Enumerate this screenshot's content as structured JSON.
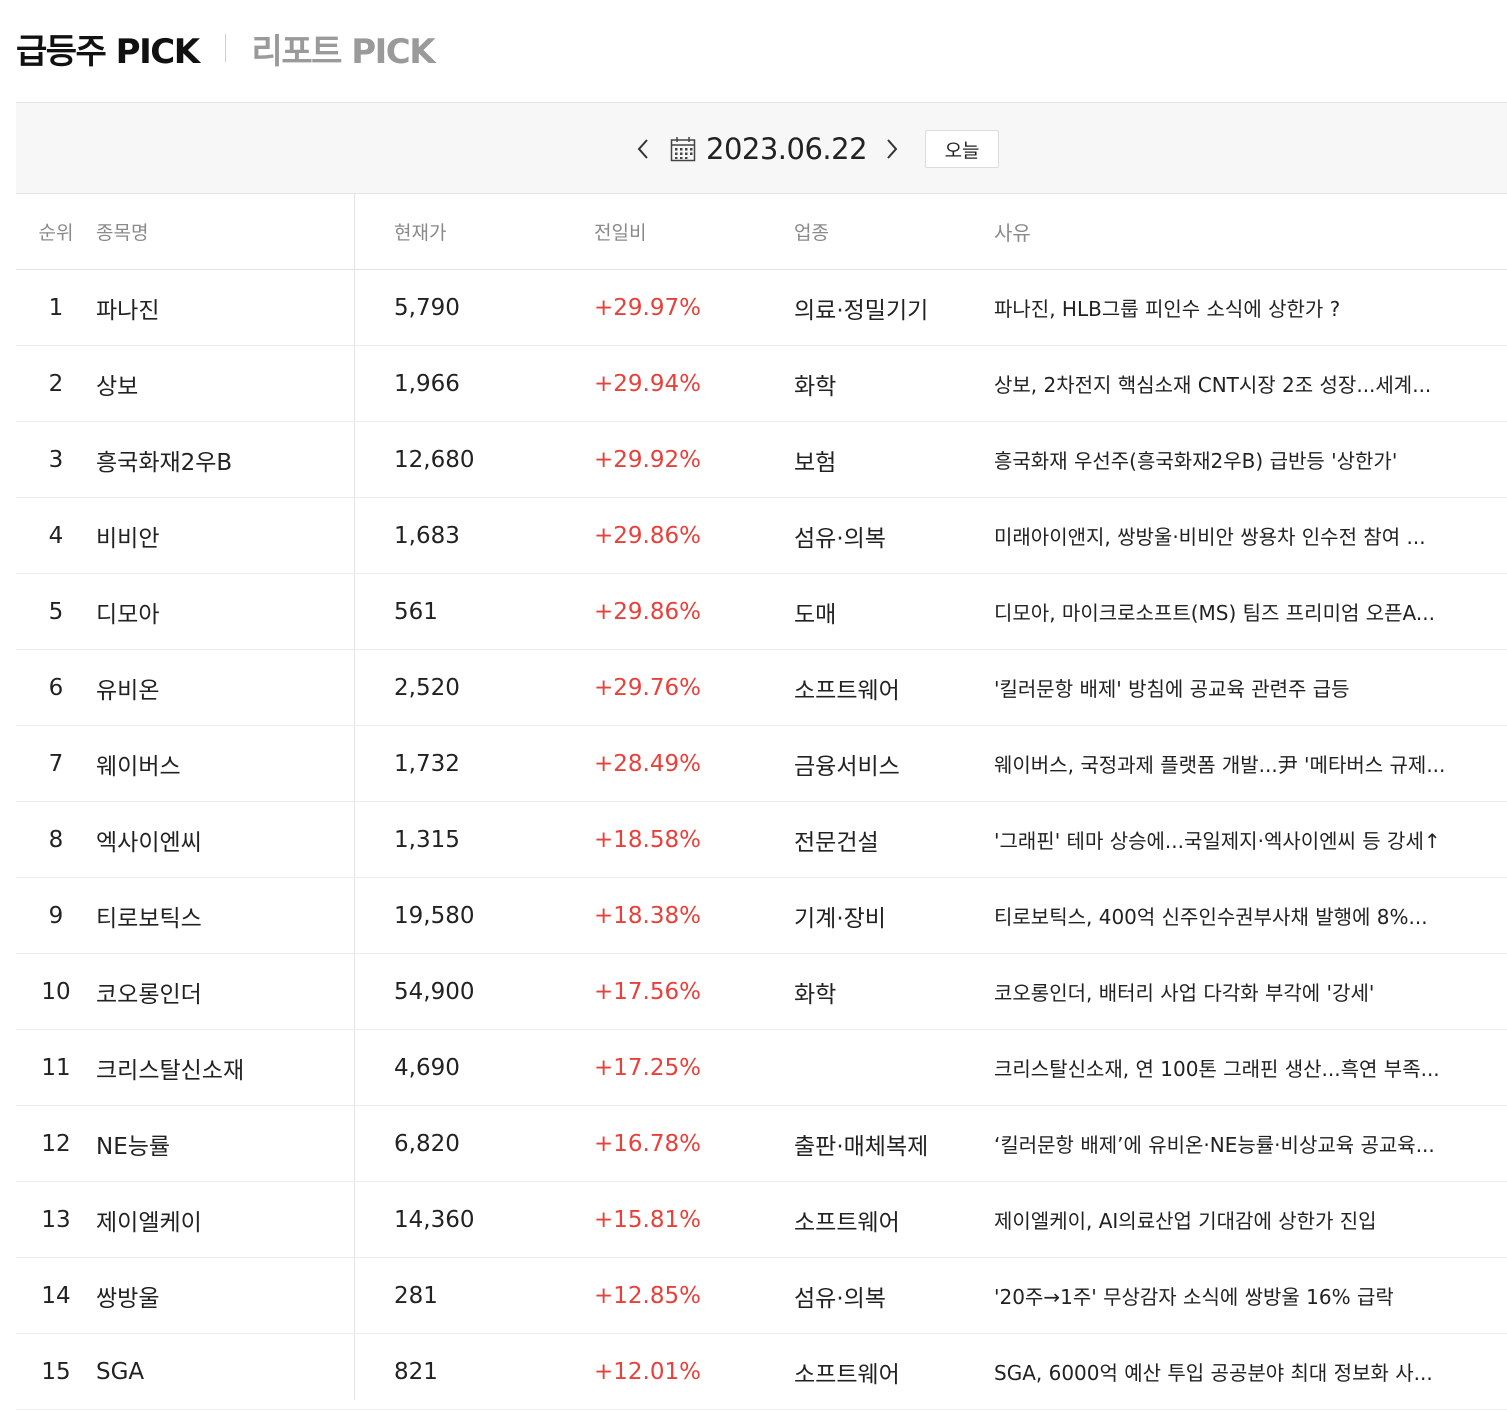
{
  "tabs": {
    "active": "급등주 PICK",
    "inactive": "리포트 PICK"
  },
  "date_bar": {
    "date": "2023.06.22",
    "today_label": "오늘",
    "prev_icon": "chevron-left-icon",
    "next_icon": "chevron-right-icon",
    "calendar_icon": "calendar-icon"
  },
  "table": {
    "headers": {
      "rank": "순위",
      "name": "종목명",
      "price": "현재가",
      "change": "전일비",
      "sector": "업종",
      "reason": "사유"
    },
    "rows": [
      {
        "rank": "1",
        "name": "파나진",
        "price": "5,790",
        "change": "+29.97%",
        "sector": "의료·정밀기기",
        "reason": "파나진, HLB그룹 피인수 소식에 상한가 ?"
      },
      {
        "rank": "2",
        "name": "상보",
        "price": "1,966",
        "change": "+29.94%",
        "sector": "화학",
        "reason": "상보, 2차전지 핵심소재 CNT시장 2조 성장...세계..."
      },
      {
        "rank": "3",
        "name": "흥국화재2우B",
        "price": "12,680",
        "change": "+29.92%",
        "sector": "보험",
        "reason": "흥국화재 우선주(흥국화재2우B) 급반등 '상한가'"
      },
      {
        "rank": "4",
        "name": "비비안",
        "price": "1,683",
        "change": "+29.86%",
        "sector": "섬유·의복",
        "reason": "미래아이앤지, 쌍방울·비비안 쌍용차 인수전 참여 ..."
      },
      {
        "rank": "5",
        "name": "디모아",
        "price": "561",
        "change": "+29.86%",
        "sector": "도매",
        "reason": "디모아, 마이크로소프트(MS) 팀즈 프리미엄 오픈A..."
      },
      {
        "rank": "6",
        "name": "유비온",
        "price": "2,520",
        "change": "+29.76%",
        "sector": "소프트웨어",
        "reason": "'킬러문항 배제' 방침에 공교육 관련주 급등"
      },
      {
        "rank": "7",
        "name": "웨이버스",
        "price": "1,732",
        "change": "+28.49%",
        "sector": "금융서비스",
        "reason": "웨이버스, 국정과제 플랫폼 개발...尹 '메타버스 규제..."
      },
      {
        "rank": "8",
        "name": "엑사이엔씨",
        "price": "1,315",
        "change": "+18.58%",
        "sector": "전문건설",
        "reason": "'그래핀' 테마 상승에...국일제지·엑사이엔씨 등 강세↑"
      },
      {
        "rank": "9",
        "name": "티로보틱스",
        "price": "19,580",
        "change": "+18.38%",
        "sector": "기계·장비",
        "reason": "티로보틱스, 400억 신주인수권부사채 발행에 8%..."
      },
      {
        "rank": "10",
        "name": "코오롱인더",
        "price": "54,900",
        "change": "+17.56%",
        "sector": "화학",
        "reason": "코오롱인더, 배터리 사업 다각화 부각에 '강세'"
      },
      {
        "rank": "11",
        "name": "크리스탈신소재",
        "price": "4,690",
        "change": "+17.25%",
        "sector": "",
        "reason": "크리스탈신소재, 연 100톤 그래핀 생산...흑연 부족..."
      },
      {
        "rank": "12",
        "name": "NE능률",
        "price": "6,820",
        "change": "+16.78%",
        "sector": "출판·매체복제",
        "reason": "‘킬러문항 배제’에 유비온·NE능률·비상교육 공교육..."
      },
      {
        "rank": "13",
        "name": "제이엘케이",
        "price": "14,360",
        "change": "+15.81%",
        "sector": "소프트웨어",
        "reason": "제이엘케이, AI의료산업 기대감에 상한가 진입"
      },
      {
        "rank": "14",
        "name": "쌍방울",
        "price": "281",
        "change": "+12.85%",
        "sector": "섬유·의복",
        "reason": "'20주→1주' 무상감자 소식에 쌍방울 16% 급락"
      },
      {
        "rank": "15",
        "name": "SGA",
        "price": "821",
        "change": "+12.01%",
        "sector": "소프트웨어",
        "reason": "SGA, 6000억 예산 투입 공공분야 최대 정보화 사..."
      }
    ]
  }
}
